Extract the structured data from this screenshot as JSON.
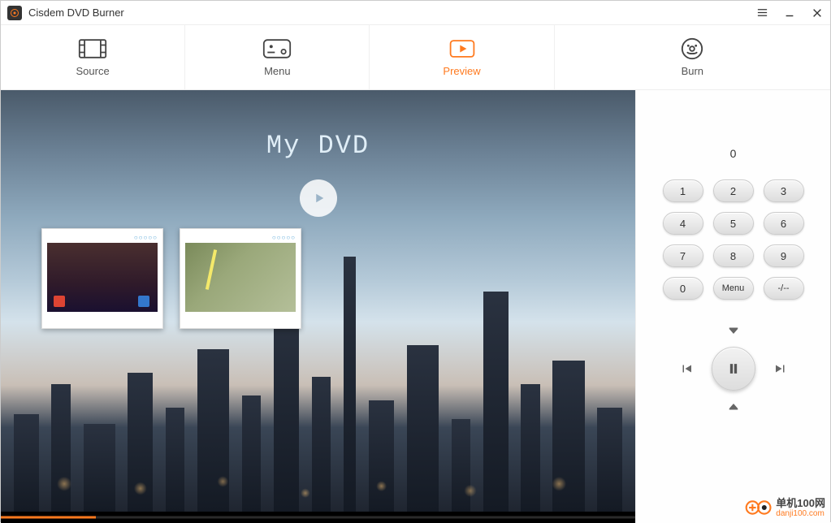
{
  "titlebar": {
    "title": "Cisdem DVD Burner"
  },
  "toolbar": {
    "tabs": [
      {
        "label": "Source"
      },
      {
        "label": "Menu"
      },
      {
        "label": "Preview"
      },
      {
        "label": "Burn"
      }
    ],
    "active_index": 2
  },
  "preview": {
    "dvd_title": "My DVD",
    "progress_percent": 15
  },
  "remote": {
    "display": "0",
    "keys": [
      "1",
      "2",
      "3",
      "4",
      "5",
      "6",
      "7",
      "8",
      "9",
      "0",
      "Menu",
      "-/--"
    ]
  },
  "watermark": {
    "cn": "单机100网",
    "url": "danji100.com"
  }
}
